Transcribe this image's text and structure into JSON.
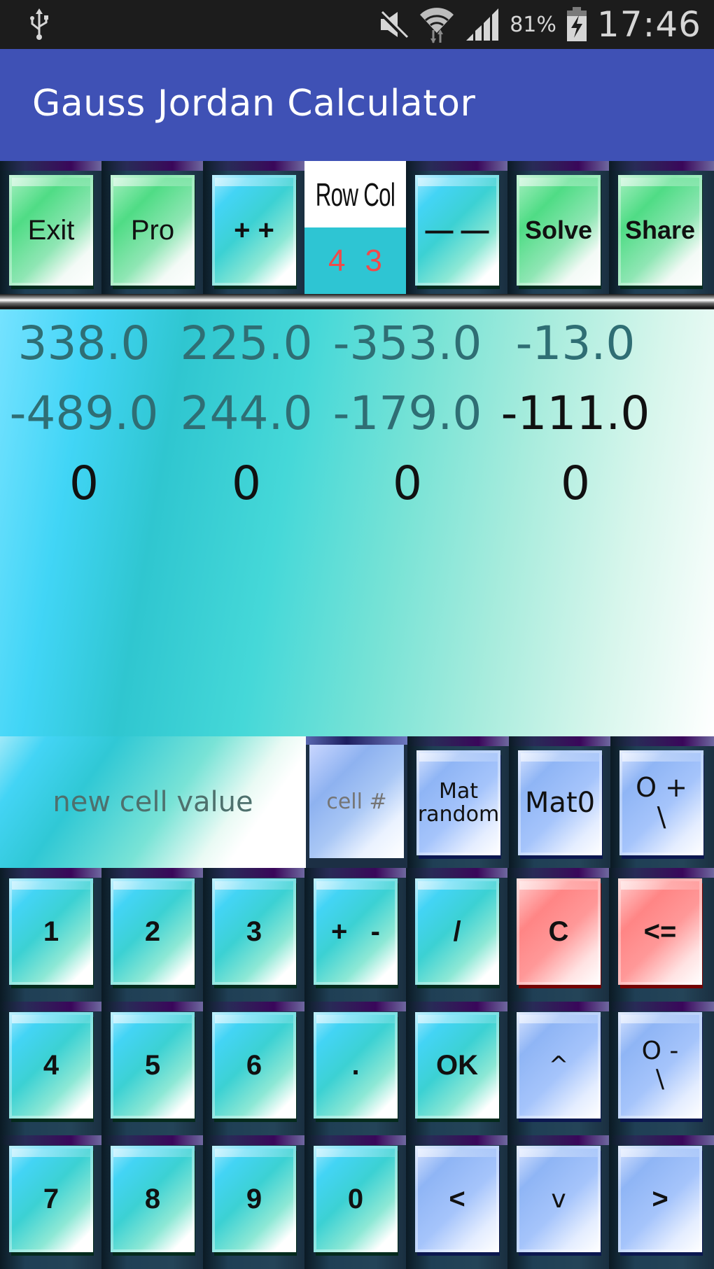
{
  "status_bar": {
    "left_icons": [
      "usb-icon"
    ],
    "right_icons": [
      "mute-icon",
      "wifi-icon",
      "signal-icon"
    ],
    "battery_percent": "81%",
    "battery_icon": "battery-charging-icon",
    "time": "17:46"
  },
  "app": {
    "title": "Gauss Jordan Calculator",
    "colors": {
      "title_bar": "#3f51b5",
      "status_bar": "#1c1c1c",
      "rowcol_values": "#ef4a4a",
      "rowcol_bg": "#2ec5d3"
    }
  },
  "toolbar": {
    "exit": "Exit",
    "pro": "Pro",
    "add": "+ +",
    "rowcol_label": "Row Col",
    "row_value": "4",
    "col_value": "3",
    "remove": "— —",
    "solve": "Solve",
    "share": "Share"
  },
  "matrix": {
    "rows": [
      [
        "338.0",
        "225.0",
        "-353.0",
        "-13.0"
      ],
      [
        "-489.0",
        "244.0",
        "-179.0",
        "-111.0"
      ],
      [
        "0",
        "0",
        "0",
        "0"
      ]
    ],
    "selected_cell": "-111.0"
  },
  "input_row": {
    "new_cell_placeholder": "new cell value",
    "cell_number_placeholder": "cell #",
    "mat_random_line1": "Mat",
    "mat_random_line2": "random",
    "mat0": "Mat0",
    "o_plus_line1": "O +",
    "o_plus_line2": "\\"
  },
  "keypad": {
    "row1": [
      "1",
      "2",
      "3",
      "+   -",
      "/",
      "C",
      "<="
    ],
    "row2": [
      "4",
      "5",
      "6",
      ".",
      "OK",
      "^",
      ""
    ],
    "row2_o_minus_line1": "O -",
    "row2_o_minus_line2": "\\",
    "row3": [
      "7",
      "8",
      "9",
      "0",
      "<",
      "v",
      ">"
    ]
  }
}
